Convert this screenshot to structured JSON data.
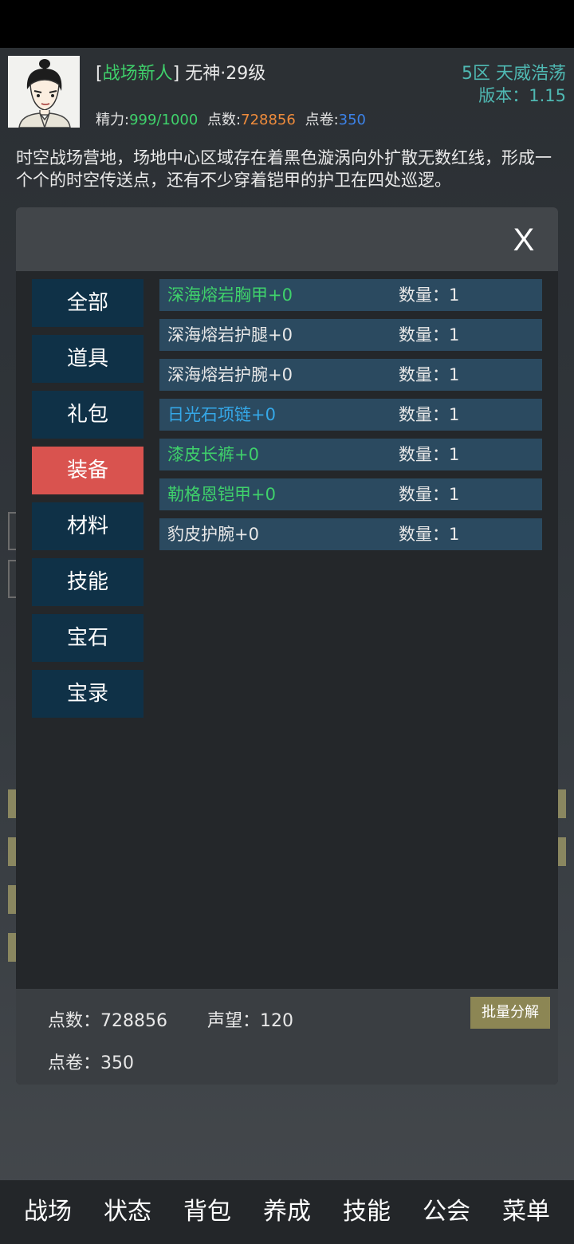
{
  "header": {
    "title_tag": "战场新人",
    "player_name": "无神",
    "level": "29级",
    "server": "5区 天威浩荡",
    "version_label": "版本：",
    "version_value": "1.15",
    "energy_label": "精力:",
    "energy_value": "999/1000",
    "points_label": "点数:",
    "points_value": "728856",
    "tickets_label": "点卷:",
    "tickets_value": "350",
    "avatar_icon": "swordsman-portrait-icon"
  },
  "description": "时空战场营地，场地中心区域存在着黑色漩涡向外扩散无数红线，形成一个个的时空传送点，还有不少穿着铠甲的护卫在四处巡逻。",
  "modal": {
    "close_label": "X",
    "categories": [
      {
        "label": "全部",
        "active": false
      },
      {
        "label": "道具",
        "active": false
      },
      {
        "label": "礼包",
        "active": false
      },
      {
        "label": "装备",
        "active": true
      },
      {
        "label": "材料",
        "active": false
      },
      {
        "label": "技能",
        "active": false
      },
      {
        "label": "宝石",
        "active": false
      },
      {
        "label": "宝录",
        "active": false
      }
    ],
    "items": [
      {
        "name": "深海熔岩胸甲+0",
        "qty_label": "数量：",
        "qty": "1",
        "color": "#3fd16b"
      },
      {
        "name": "深海熔岩护腿+0",
        "qty_label": "数量：",
        "qty": "1",
        "color": "#e8e8e8"
      },
      {
        "name": "深海熔岩护腕+0",
        "qty_label": "数量：",
        "qty": "1",
        "color": "#e8e8e8"
      },
      {
        "name": "日光石项链+0",
        "qty_label": "数量：",
        "qty": "1",
        "color": "#35a8e8"
      },
      {
        "name": "漆皮长裤+0",
        "qty_label": "数量：",
        "qty": "1",
        "color": "#3fd16b"
      },
      {
        "name": "勒格恩铠甲+0",
        "qty_label": "数量：",
        "qty": "1",
        "color": "#3fd16b"
      },
      {
        "name": "豹皮护腕+0",
        "qty_label": "数量：",
        "qty": "1",
        "color": "#e8e8e8"
      }
    ],
    "footer": {
      "points_label": "点数：",
      "points_value": "728856",
      "fame_label": "声望：",
      "fame_value": "120",
      "tickets_label": "点卷：",
      "tickets_value": "350",
      "batch_button": "批量分解"
    }
  },
  "bottom_nav": [
    "战场",
    "状态",
    "背包",
    "养成",
    "技能",
    "公会",
    "菜单"
  ],
  "colors": {
    "accent_green": "#3fd16b",
    "accent_blue": "#35a8e8",
    "tab_active": "#d9534f",
    "tab_inactive": "#0f3147",
    "row_bg": "#2b4a60"
  }
}
